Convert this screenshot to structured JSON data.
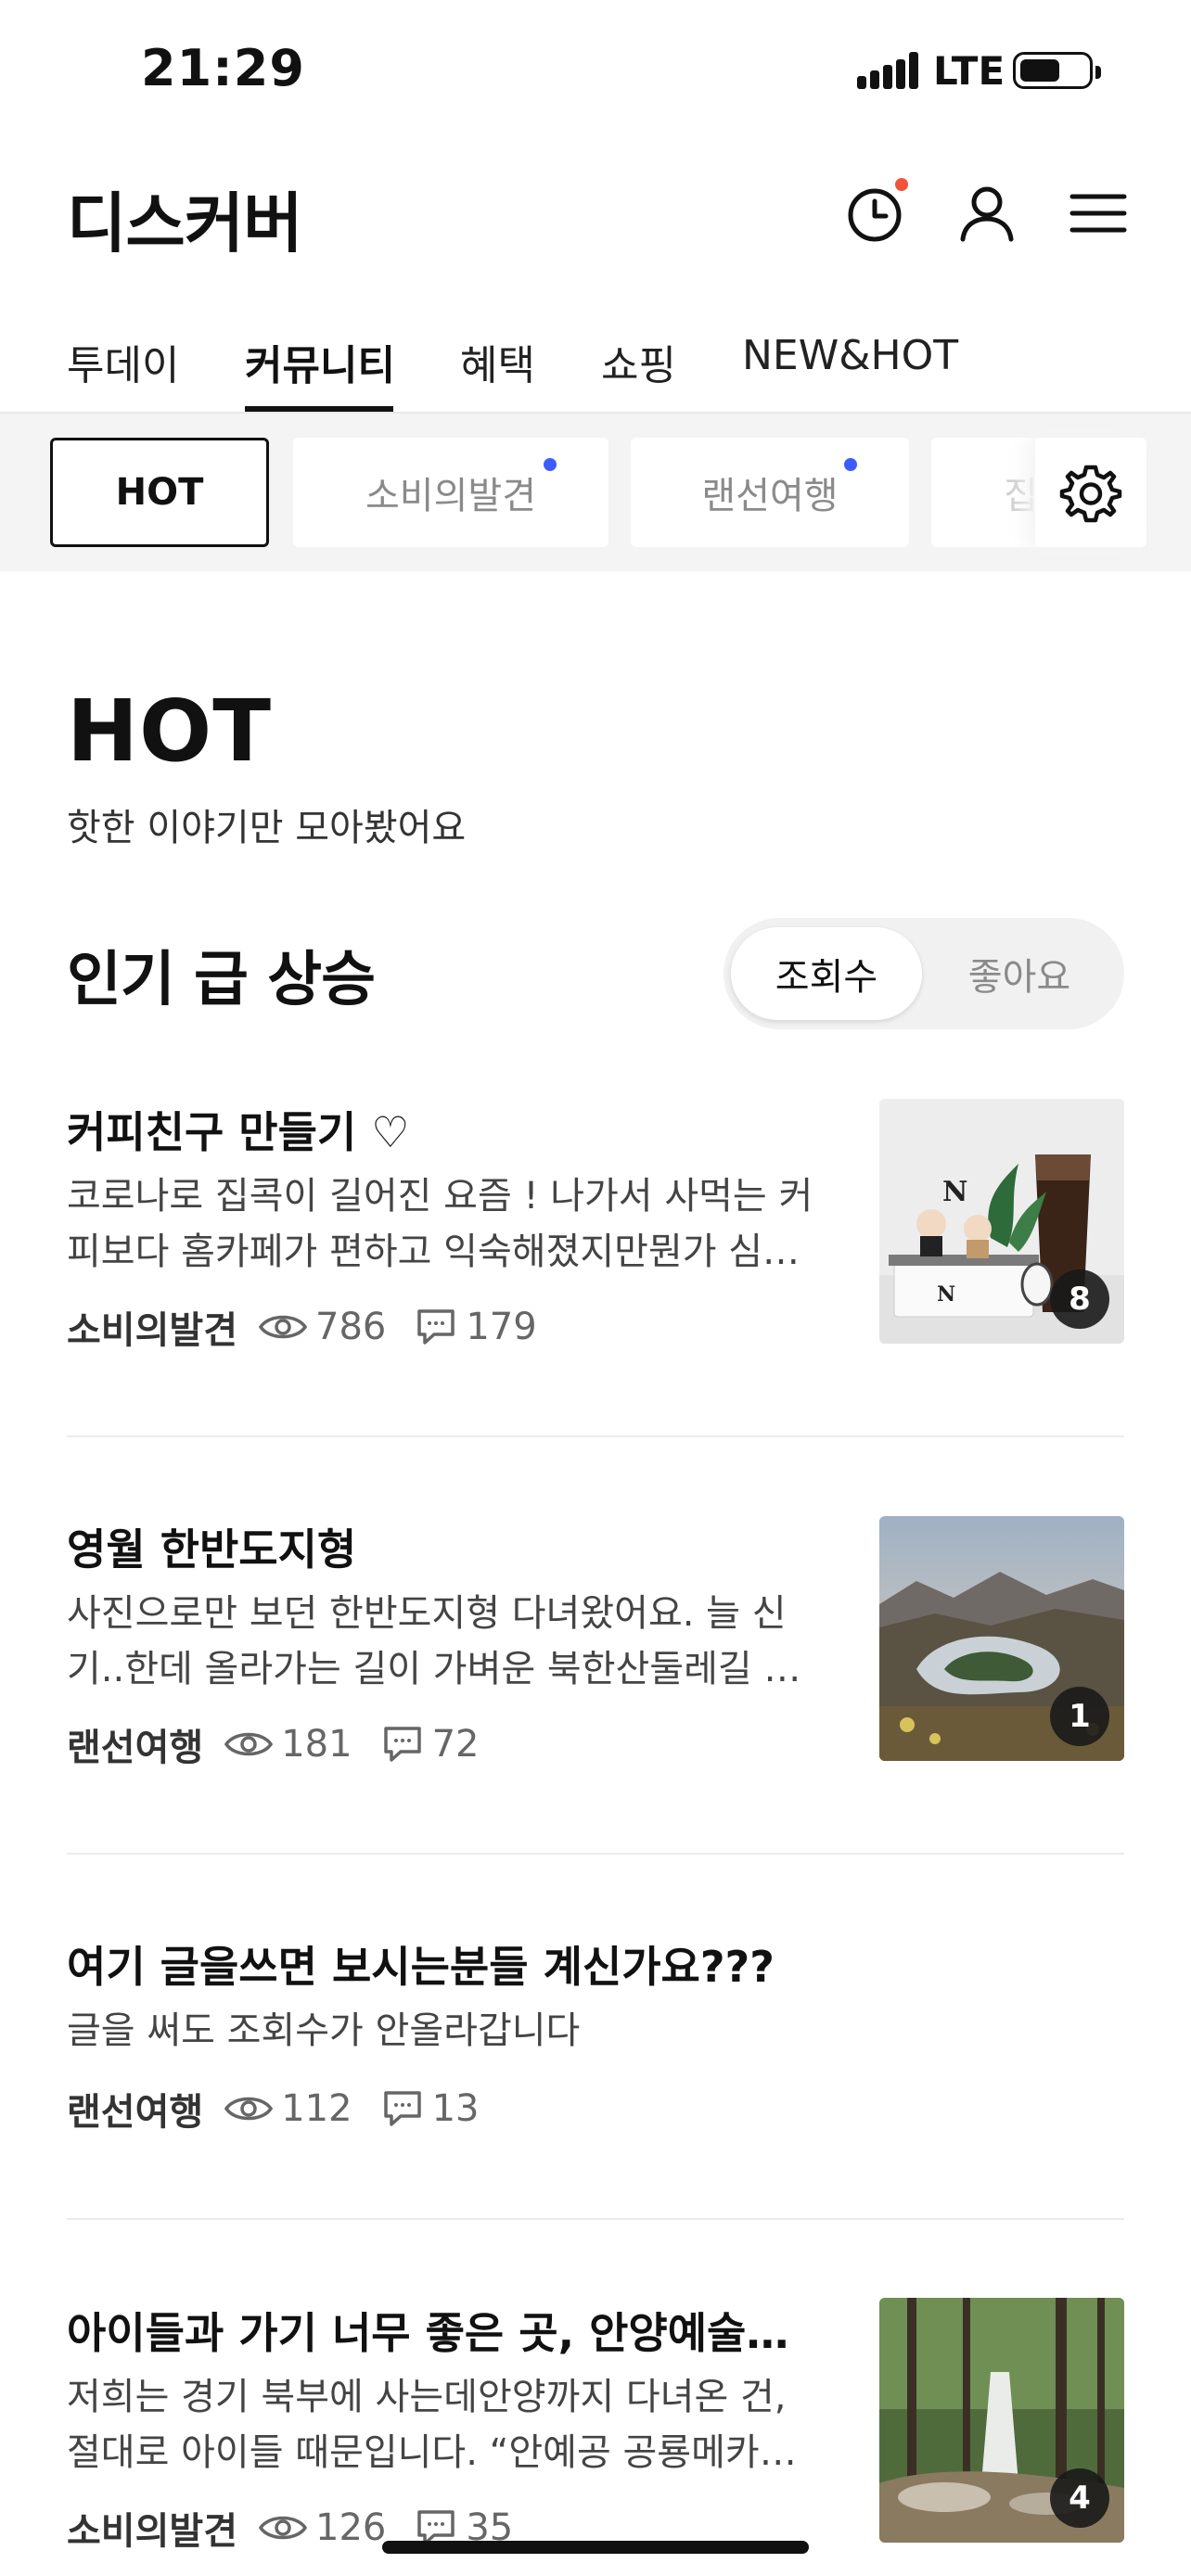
{
  "status_bar": {
    "time": "21:29",
    "network": "LTE"
  },
  "header": {
    "title": "디스커버",
    "icons": [
      "clock-icon",
      "profile-icon",
      "menu-icon"
    ],
    "accent": "#f0543b"
  },
  "tabs": [
    {
      "label": "투데이",
      "active": false
    },
    {
      "label": "커뮤니티",
      "active": true
    },
    {
      "label": "혜택",
      "active": false
    },
    {
      "label": "쇼핑",
      "active": false
    },
    {
      "label": "NEW&HOT",
      "active": false
    }
  ],
  "chips": [
    {
      "label": "HOT",
      "active": true,
      "new": false
    },
    {
      "label": "소비의발견",
      "active": false,
      "new": true
    },
    {
      "label": "랜선여행",
      "active": false,
      "new": true
    },
    {
      "label": "집",
      "active": false,
      "new": false
    }
  ],
  "hot": {
    "title": "HOT",
    "subtitle": "핫한 이야기만 모아봤어요"
  },
  "section": {
    "title": "인기 급 상승",
    "sort_options": [
      {
        "label": "조회수",
        "selected": true
      },
      {
        "label": "좋아요",
        "selected": false
      }
    ]
  },
  "posts": [
    {
      "title": "커피친구 만들기 ♡",
      "excerpt": [
        "코로나로 집콕이 길어진 요즘 ! 나가서 사먹는 커",
        "피보다 홈카페가 편하고 익숙해졌지만뭔가 심…"
      ],
      "category": "소비의발견",
      "views": "786",
      "comments": "179",
      "image_count": "8"
    },
    {
      "title": "영월 한반도지형",
      "excerpt": [
        "사진으로만 보던 한반도지형 다녀왔어요. 늘 신",
        "기..한데 올라가는 길이 가벼운 북한산둘레길 …"
      ],
      "category": "랜선여행",
      "views": "181",
      "comments": "72",
      "image_count": "1"
    },
    {
      "title": "여기 글을쓰면 보시는분들 계신가요???",
      "excerpt": [
        "글을 써도 조회수가 안올라갑니다"
      ],
      "category": "랜선여행",
      "views": "112",
      "comments": "13",
      "image_count": null
    },
    {
      "title": "아이들과 가기 너무 좋은 곳, 안양예술공…",
      "excerpt": [
        "저희는 경기 북부에 사는데안양까지 다녀온 건,",
        "절대로 아이들 때문입니다. “안예공 공룡메카…"
      ],
      "category": "소비의발견",
      "views": "126",
      "comments": "35",
      "image_count": "4"
    }
  ],
  "colors": {
    "new_dot": "#3d5cff",
    "chip_bar_bg": "#f4f4f5",
    "text": "#111111"
  }
}
